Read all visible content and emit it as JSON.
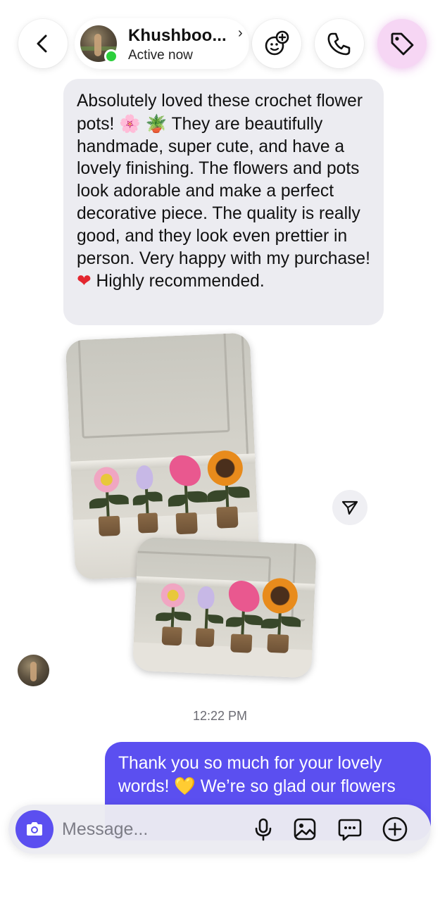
{
  "header": {
    "contact_name": "Khushboo...",
    "name_chevron": "›",
    "status": "Active now",
    "back_icon": "chevron-left-icon",
    "effects_icon": "effects-add-icon",
    "call_icon": "phone-icon",
    "tag_icon": "tag-icon",
    "accent_tag_bg": "#f6d6f4",
    "online_color": "#2ccf3c"
  },
  "messages": {
    "incoming_text_1": "Absolutely loved these crochet flower pots! ",
    "incoming_emoji_1": "🌸",
    "incoming_emoji_2": "🪴",
    "incoming_text_2": " They are beautifully handmade, super cute, and have a lovely finishing. The flowers and pots look adorable and make a perfect decorative piece. The quality is really good, and they look even prettier in person. Very happy with my purchase! ",
    "incoming_emoji_3": "❤",
    "incoming_text_3": " Highly recommended.",
    "timestamp": "12:22 PM",
    "outgoing_text_1": "Thank you so much for your lovely words! ",
    "outgoing_emoji_1": "💛",
    "outgoing_text_2": " We’re so glad our flowers",
    "incoming_bubble_color": "#ececf1",
    "outgoing_bubble_color": "#5b4ff0"
  },
  "composer": {
    "placeholder": "Message...",
    "camera_icon": "camera-icon",
    "mic_icon": "microphone-icon",
    "gallery_icon": "image-gallery-icon",
    "sticker_icon": "sticker-chat-icon",
    "plus_icon": "plus-circle-icon"
  }
}
